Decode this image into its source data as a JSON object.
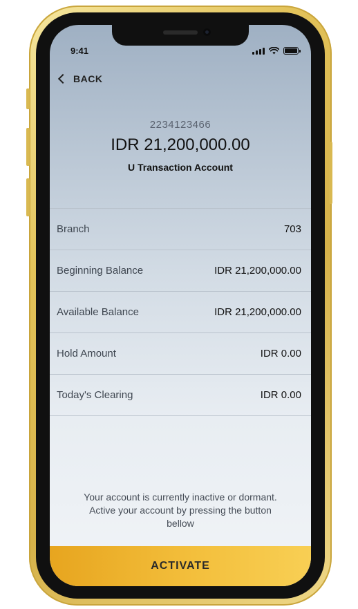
{
  "status_bar": {
    "time": "9:41"
  },
  "nav": {
    "back_label": "BACK"
  },
  "account": {
    "number": "2234123466",
    "balance": "IDR 21,200,000.00",
    "name": "U Transaction Account"
  },
  "details": [
    {
      "label": "Branch",
      "value": "703"
    },
    {
      "label": "Beginning Balance",
      "value": "IDR 21,200,000.00"
    },
    {
      "label": "Available Balance",
      "value": "IDR 21,200,000.00"
    },
    {
      "label": "Hold Amount",
      "value": "IDR 0.00"
    },
    {
      "label": "Today's Clearing",
      "value": "IDR 0.00"
    }
  ],
  "notice": {
    "line1": "Your account is currently inactive or dormant.",
    "line2": "Active your account by pressing the button",
    "line3": "bellow"
  },
  "action": {
    "activate_label": "ACTIVATE"
  },
  "colors": {
    "accent": "#f3bf3c",
    "frame": "#e3c35a"
  }
}
